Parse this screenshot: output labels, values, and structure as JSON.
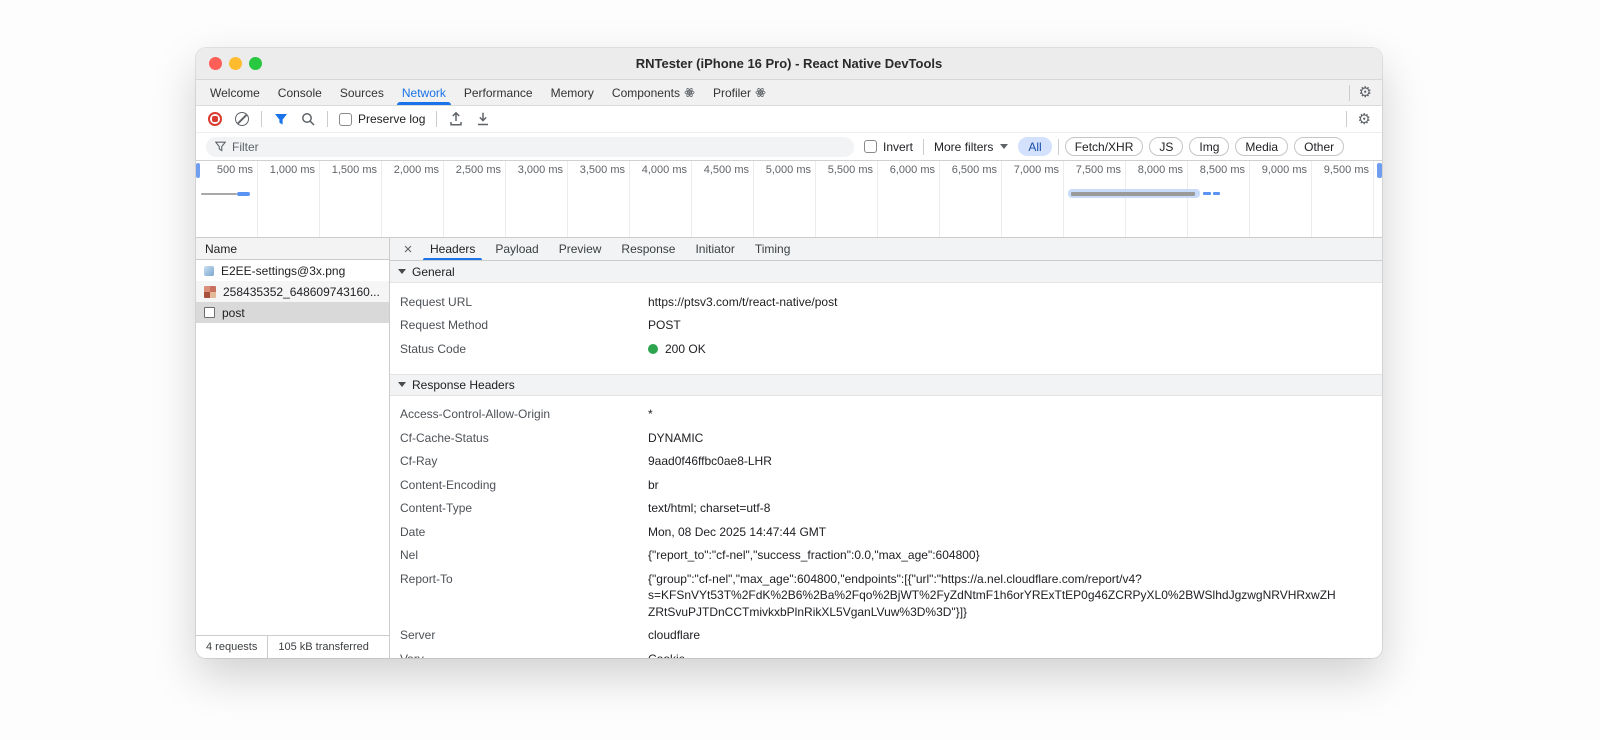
{
  "window": {
    "title": "RNTester (iPhone 16 Pro) - React Native DevTools"
  },
  "tabbar": {
    "tabs": [
      {
        "label": "Welcome"
      },
      {
        "label": "Console"
      },
      {
        "label": "Sources"
      },
      {
        "label": "Network",
        "active": true
      },
      {
        "label": "Performance"
      },
      {
        "label": "Memory"
      },
      {
        "label": "Components",
        "atom": true
      },
      {
        "label": "Profiler",
        "atom": true
      }
    ]
  },
  "toolbar": {
    "preserve_log_label": "Preserve log"
  },
  "filterbar": {
    "filter_placeholder": "Filter",
    "invert_label": "Invert",
    "more_filters_label": "More filters",
    "chips": [
      {
        "label": "All",
        "active": true
      },
      {
        "label": "Fetch/XHR"
      },
      {
        "label": "JS"
      },
      {
        "label": "Img"
      },
      {
        "label": "Media"
      },
      {
        "label": "Other"
      }
    ]
  },
  "timeline": {
    "tick_labels": [
      "500 ms",
      "1,000 ms",
      "1,500 ms",
      "2,000 ms",
      "2,500 ms",
      "3,000 ms",
      "3,500 ms",
      "4,000 ms",
      "4,500 ms",
      "5,000 ms",
      "5,500 ms",
      "6,000 ms",
      "6,500 ms",
      "7,000 ms",
      "7,500 ms",
      "8,000 ms",
      "8,500 ms",
      "9,000 ms",
      "9,500 ms"
    ]
  },
  "requests": {
    "name_header": "Name",
    "rows": [
      {
        "name": "E2EE-settings@3x.png",
        "type": "image"
      },
      {
        "name": "258435352_648609743160...",
        "type": "image"
      },
      {
        "name": "post",
        "type": "document",
        "selected": true
      }
    ]
  },
  "status_bar": {
    "requests_count": "4 requests",
    "transferred": "105 kB transferred"
  },
  "detail": {
    "tabs": [
      {
        "label": "Headers",
        "active": true
      },
      {
        "label": "Payload"
      },
      {
        "label": "Preview"
      },
      {
        "label": "Response"
      },
      {
        "label": "Initiator"
      },
      {
        "label": "Timing"
      }
    ],
    "general": {
      "title": "General",
      "rows": [
        {
          "name": "Request URL",
          "value": "https://ptsv3.com/t/react-native/post"
        },
        {
          "name": "Request Method",
          "value": "POST"
        },
        {
          "name": "Status Code",
          "value": "200 OK",
          "status_dot": true
        }
      ]
    },
    "response_headers": {
      "title": "Response Headers",
      "rows": [
        {
          "name": "Access-Control-Allow-Origin",
          "value": "*"
        },
        {
          "name": "Cf-Cache-Status",
          "value": "DYNAMIC"
        },
        {
          "name": "Cf-Ray",
          "value": "9aad0f46ffbc0ae8-LHR"
        },
        {
          "name": "Content-Encoding",
          "value": "br"
        },
        {
          "name": "Content-Type",
          "value": "text/html; charset=utf-8"
        },
        {
          "name": "Date",
          "value": "Mon, 08 Dec 2025 14:47:44 GMT"
        },
        {
          "name": "Nel",
          "value": "{\"report_to\":\"cf-nel\",\"success_fraction\":0.0,\"max_age\":604800}"
        },
        {
          "name": "Report-To",
          "value": "{\"group\":\"cf-nel\",\"max_age\":604800,\"endpoints\":[{\"url\":\"https://a.nel.cloudflare.com/report/v4?\ns=KFSnVYt53T%2FdK%2B6%2Ba%2Fqo%2BjWT%2FyZdNtmF1h6orYRExTtEP0g46ZCRPyXL0%2BWSlhdJgzwgNRVHRxwZH\nZRtSvuPJTDnCCTmivkxbPlnRikXL5VganLVuw%3D%3D\"}]}"
        },
        {
          "name": "Server",
          "value": "cloudflare"
        },
        {
          "name": "Vary",
          "value": "Cookie"
        }
      ]
    }
  },
  "colors": {
    "accent_blue": "#1a73e8",
    "status_green": "#2da44e",
    "record_red": "#d93b30",
    "chip_active_bg": "#d3e1fc"
  }
}
